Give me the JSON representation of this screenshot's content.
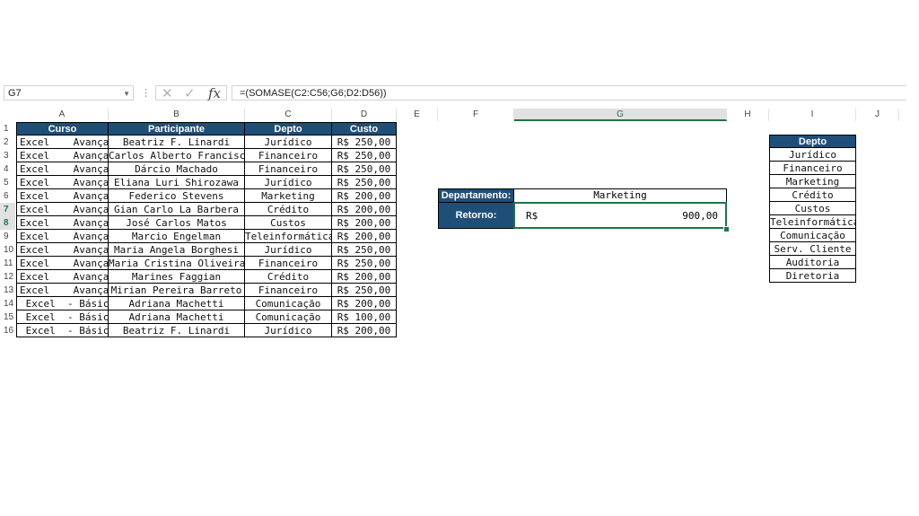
{
  "formula_bar": {
    "name_box": "G7",
    "formula": "=(SOMASE(C2:C56;G6;D2:D56))",
    "cancel_icon": "close-icon",
    "enter_icon": "check-icon",
    "fx_label": "fx"
  },
  "columns": [
    "A",
    "B",
    "C",
    "D",
    "E",
    "F",
    "G",
    "H",
    "I",
    "J"
  ],
  "rows": [
    "1",
    "2",
    "3",
    "4",
    "5",
    "6",
    "7",
    "8",
    "9",
    "10",
    "11",
    "12",
    "13",
    "14",
    "15",
    "16"
  ],
  "main_table": {
    "headers": [
      "Curso",
      "Participante",
      "Depto",
      "Custo"
    ],
    "rows": [
      [
        "Excel    Avançado",
        "Beatriz F. Linardi",
        "Jurídico",
        "R$ 250,00"
      ],
      [
        "Excel    Avançado",
        "Carlos Alberto Francisco",
        "Financeiro",
        "R$ 250,00"
      ],
      [
        "Excel    Avançado",
        "Dárcio Machado",
        "Financeiro",
        "R$ 250,00"
      ],
      [
        "Excel    Avançado",
        "Eliana Luri Shirozawa",
        "Jurídico",
        "R$ 250,00"
      ],
      [
        "Excel    Avançado",
        "Federico Stevens",
        "Marketing",
        "R$ 200,00"
      ],
      [
        "Excel    Avançado",
        "Gian Carlo La Barbera",
        "Crédito",
        "R$ 200,00"
      ],
      [
        "Excel    Avançado",
        "José Carlos Matos",
        "Custos",
        "R$ 200,00"
      ],
      [
        "Excel    Avançado",
        "Marcio Engelman",
        "Teleinformática",
        "R$ 200,00"
      ],
      [
        "Excel    Avançado",
        "Maria Angela Borghesi",
        "Jurídico",
        "R$ 250,00"
      ],
      [
        "Excel    Avançado",
        "Maria Cristina Oliveira",
        "Financeiro",
        "R$ 250,00"
      ],
      [
        "Excel    Avançado",
        "Marines Faggian",
        "Crédito",
        "R$ 200,00"
      ],
      [
        "Excel    Avançado",
        "Mirian Pereira Barreto",
        "Financeiro",
        "R$ 250,00"
      ],
      [
        " Excel  - Básico",
        "Adriana Machetti",
        "Comunicação",
        "R$ 200,00"
      ],
      [
        " Excel  - Básico",
        "Adriana Machetti",
        "Comunicação",
        "R$ 100,00"
      ],
      [
        " Excel  - Básico",
        "Beatriz F. Linardi",
        "Jurídico",
        "R$ 200,00"
      ]
    ]
  },
  "summary": {
    "dept_label": "Departamento:",
    "dept_value": "Marketing",
    "return_label": "Retorno:",
    "return_currency": "R$",
    "return_value": "900,00"
  },
  "dept_list": {
    "header": "Depto",
    "items": [
      "Jurídico",
      "Financeiro",
      "Marketing",
      "Crédito",
      "Custos",
      "Teleinformática",
      "Comunicação",
      "Serv. Cliente",
      "Auditoria",
      "Diretoria"
    ]
  },
  "colors": {
    "header_fill": "#1f4e79",
    "selection": "#217346"
  }
}
